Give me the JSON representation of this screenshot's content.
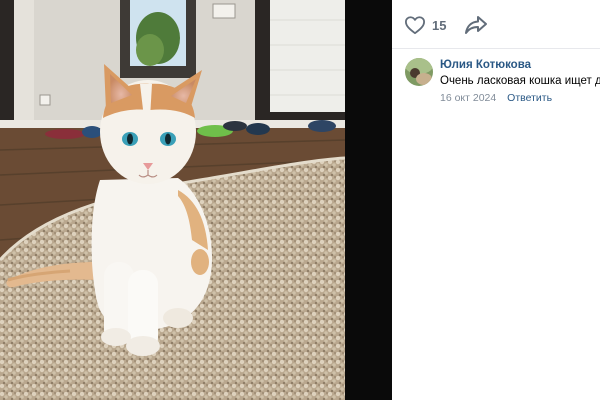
{
  "photo": {
    "subject": "cat-photo"
  },
  "actions": {
    "like_count": "15",
    "like_icon": "heart-icon",
    "share_icon": "share-icon"
  },
  "comment": {
    "author": "Юлия Котюкова",
    "text": "Очень ласковая кошка ищет до",
    "date": "16 окт 2024",
    "reply_label": "Ответить",
    "avatar_icon": "user-avatar"
  },
  "colors": {
    "link": "#2a5885",
    "muted": "#818c99",
    "icon": "#626d7a",
    "backdrop": "#000000"
  }
}
